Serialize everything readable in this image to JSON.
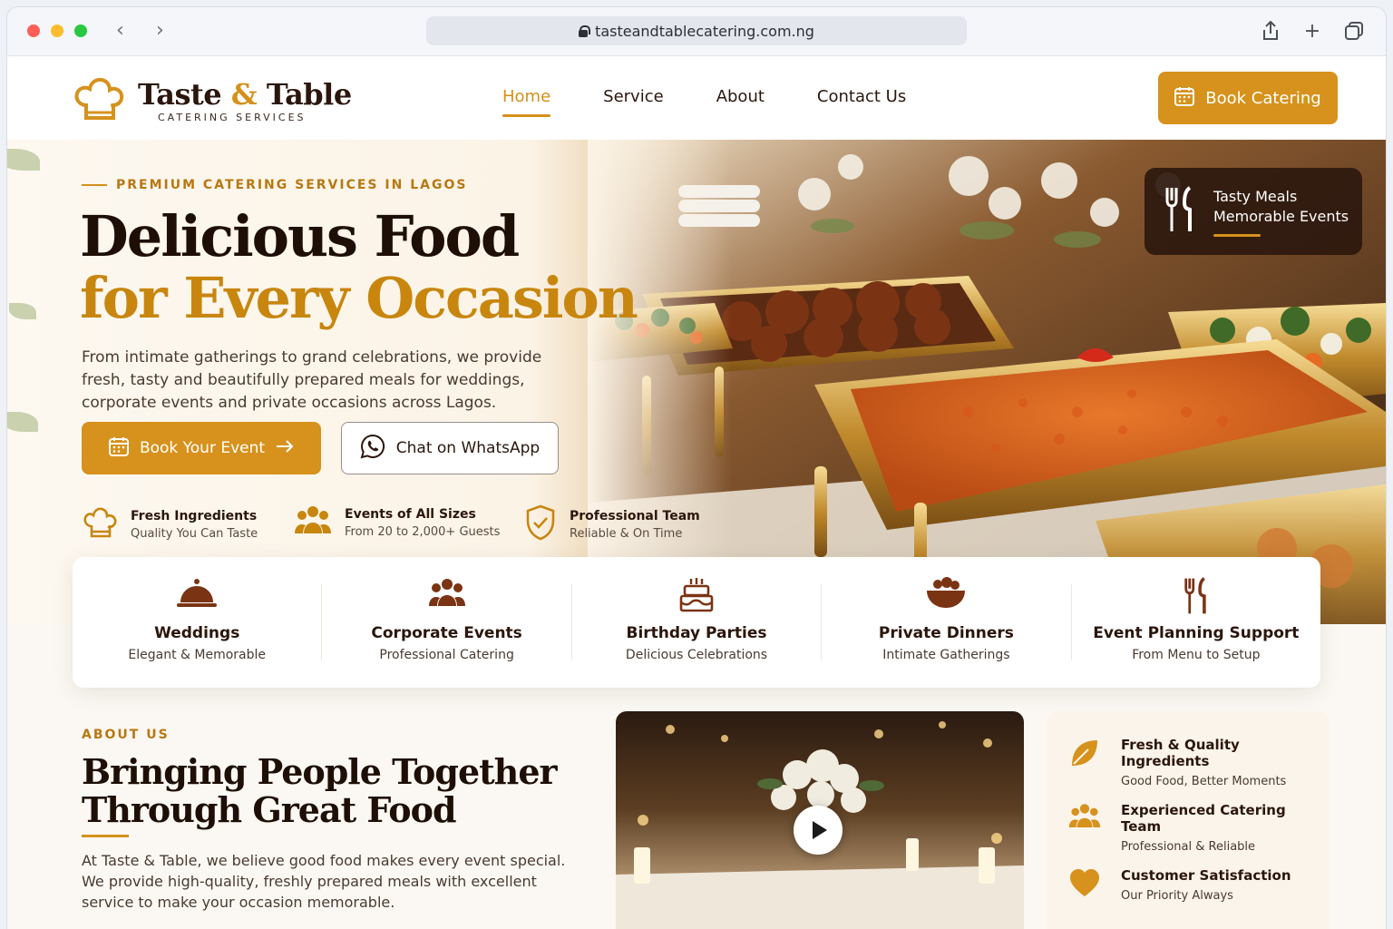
{
  "browser": {
    "url": "tasteandtablecatering.com.ng"
  },
  "brand": {
    "name_part1": "Taste",
    "name_amp": "&",
    "name_part2": "Table",
    "tagline": "CATERING SERVICES"
  },
  "nav": {
    "items": [
      {
        "label": "Home",
        "active": true
      },
      {
        "label": "Service",
        "active": false
      },
      {
        "label": "About",
        "active": false
      },
      {
        "label": "Contact Us",
        "active": false
      }
    ],
    "cta_label": "Book Catering"
  },
  "hero": {
    "eyebrow": "PREMIUM CATERING SERVICES IN LAGOS",
    "title_line1": "Delicious Food",
    "title_line2": "for Every Occasion",
    "description": "From intimate gatherings to grand celebrations, we provide fresh, tasty and beautifully prepared meals for weddings, corporate events and private occasions across Lagos.",
    "primary_cta": "Book Your Event",
    "secondary_cta": "Chat on WhatsApp",
    "features": [
      {
        "title": "Fresh Ingredients",
        "subtitle": "Quality You Can Taste",
        "icon": "chef-hat-icon"
      },
      {
        "title": "Events of All Sizes",
        "subtitle": "From 20 to 2,000+ Guests",
        "icon": "people-icon"
      },
      {
        "title": "Professional Team",
        "subtitle": "Reliable & On Time",
        "icon": "shield-check-icon"
      }
    ],
    "overlay": {
      "line1": "Tasty Meals",
      "line2": "Memorable Events"
    }
  },
  "services": [
    {
      "title": "Weddings",
      "subtitle": "Elegant & Memorable",
      "icon": "cloche-icon"
    },
    {
      "title": "Corporate Events",
      "subtitle": "Professional Catering",
      "icon": "people-icon"
    },
    {
      "title": "Birthday Parties",
      "subtitle": "Delicious Celebrations",
      "icon": "cake-icon"
    },
    {
      "title": "Private Dinners",
      "subtitle": "Intimate Gatherings",
      "icon": "bowl-icon"
    },
    {
      "title": "Event Planning Support",
      "subtitle": "From Menu to Setup",
      "icon": "cutlery-icon"
    }
  ],
  "about": {
    "eyebrow": "ABOUT US",
    "title": "Bringing People Together Through Great Food",
    "description": "At Taste & Table, we believe good food makes every event special. We provide high-quality, freshly prepared meals with excellent service to make your occasion memorable."
  },
  "why": [
    {
      "title": "Fresh & Quality Ingredients",
      "subtitle": "Good Food, Better Moments",
      "icon": "leaf-icon"
    },
    {
      "title": "Experienced Catering Team",
      "subtitle": "Professional & Reliable",
      "icon": "people-icon"
    },
    {
      "title": "Customer Satisfaction",
      "subtitle": "Our Priority Always",
      "icon": "heart-icon"
    }
  ],
  "colors": {
    "accent": "#d6921c",
    "dark": "#2b160c",
    "cream": "#fbf8f3"
  }
}
